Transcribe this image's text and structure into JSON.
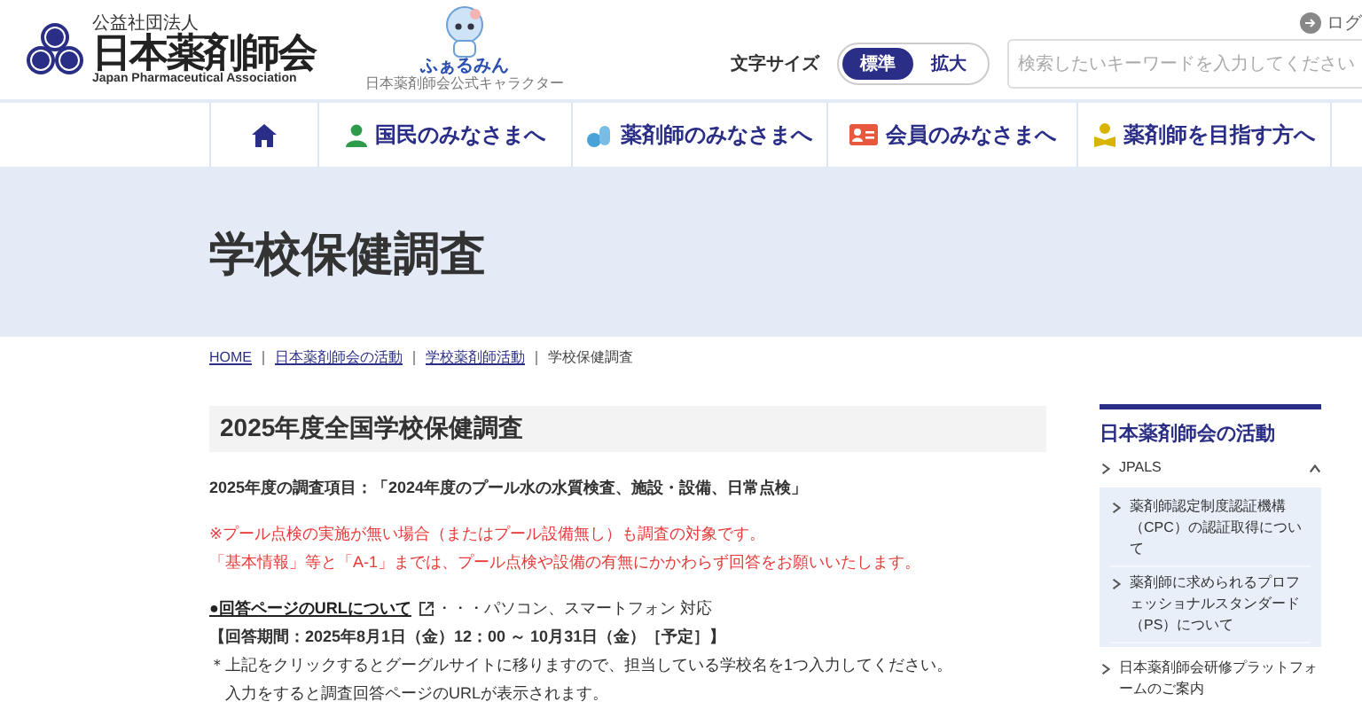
{
  "header": {
    "org_type": "公益社団法人",
    "org_name": "日本薬剤師会",
    "org_name_en": "Japan Pharmaceutical Association",
    "mascot_name": "ふぁるみん",
    "mascot_caption": "日本薬剤師会公式キャラクター",
    "login": "ログ",
    "font_size_label": "文字サイズ",
    "font_sizes": [
      {
        "label": "標準",
        "selected": true
      },
      {
        "label": "拡大",
        "selected": false
      }
    ],
    "search": {
      "placeholder": "検索したいキーワードを入力してください"
    }
  },
  "nav": [
    {
      "kind": "home"
    },
    {
      "kind": "person",
      "label": "国民のみなさまへ"
    },
    {
      "kind": "pills",
      "label": "薬剤師のみなさまへ"
    },
    {
      "kind": "card",
      "label": "会員のみなさまへ"
    },
    {
      "kind": "student",
      "label": "薬剤師を目指す方へ"
    }
  ],
  "page_title": "学校保健調査",
  "breadcrumb": [
    {
      "label": "HOME",
      "link": true
    },
    {
      "label": "日本薬剤師会の活動",
      "link": true
    },
    {
      "label": "学校薬剤師活動",
      "link": true
    },
    {
      "label": "学校保健調査",
      "link": false
    }
  ],
  "article": {
    "heading": "2025年度全国学校保健調査",
    "survey_items": "2025年度の調査項目：「2024年度のプール水の水質検査、施設・設備、日常点検」",
    "notices": [
      "※プール点検の実施が無い場合（またはプール設備無し）も調査の対象です。",
      "「基本情報」等と「A-1」までは、プール点検や設備の有無にかかわらず回答をお願いいたします。"
    ],
    "url_link": "●回答ページのURLについて",
    "url_note": "・・・パソコン、スマートフォン 対応",
    "period": "【回答期間：2025年8月1日（金）12：00 ～ 10月31日（金）［予定］】",
    "instructions": [
      "＊上記をクリックするとグーグルサイトに移りますので、担当している学校名を1つ入力してください。",
      "　入力をすると調査回答ページのURLが表示されます。"
    ]
  },
  "sidebar": {
    "title": "日本薬剤師会の活動",
    "items": [
      {
        "label": "JPALS",
        "expanded": true,
        "children": [
          {
            "label": "薬剤師認定制度認証機構（CPC）の認証取得について"
          },
          {
            "label": "薬剤師に求められるプロフェッショナルスタンダード（PS）について"
          }
        ]
      },
      {
        "label": "日本薬剤師会研修プラットフォームのご案内"
      }
    ]
  }
}
